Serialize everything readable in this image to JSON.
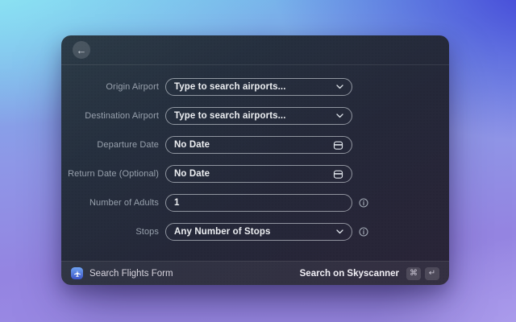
{
  "window": {
    "back_button_glyph": "←"
  },
  "form": {
    "fields": [
      {
        "label": "Origin Airport",
        "value": "Type to search airports...",
        "type": "select"
      },
      {
        "label": "Destination Airport",
        "value": "Type to search airports...",
        "type": "select"
      },
      {
        "label": "Departure Date",
        "value": "No Date",
        "type": "date"
      },
      {
        "label": "Return Date (Optional)",
        "value": "No Date",
        "type": "date"
      },
      {
        "label": "Number of Adults",
        "value": "1",
        "type": "text",
        "info": true
      },
      {
        "label": "Stops",
        "value": "Any Number of Stops",
        "type": "select",
        "info": true
      }
    ]
  },
  "footer": {
    "app_icon": "airplane-icon",
    "form_title": "Search Flights Form",
    "primary_action": "Search on Skyscanner",
    "shortcut_keys": [
      "⌘",
      "↵"
    ]
  },
  "colors": {
    "app_icon_blue": "#4a6de0",
    "background_top_left": "#8feaf4",
    "background_top_right": "#3e3cd6",
    "background_bottom": "#9887e4",
    "modal_top": "#2d3c48",
    "modal_bottom": "#2a2438"
  }
}
